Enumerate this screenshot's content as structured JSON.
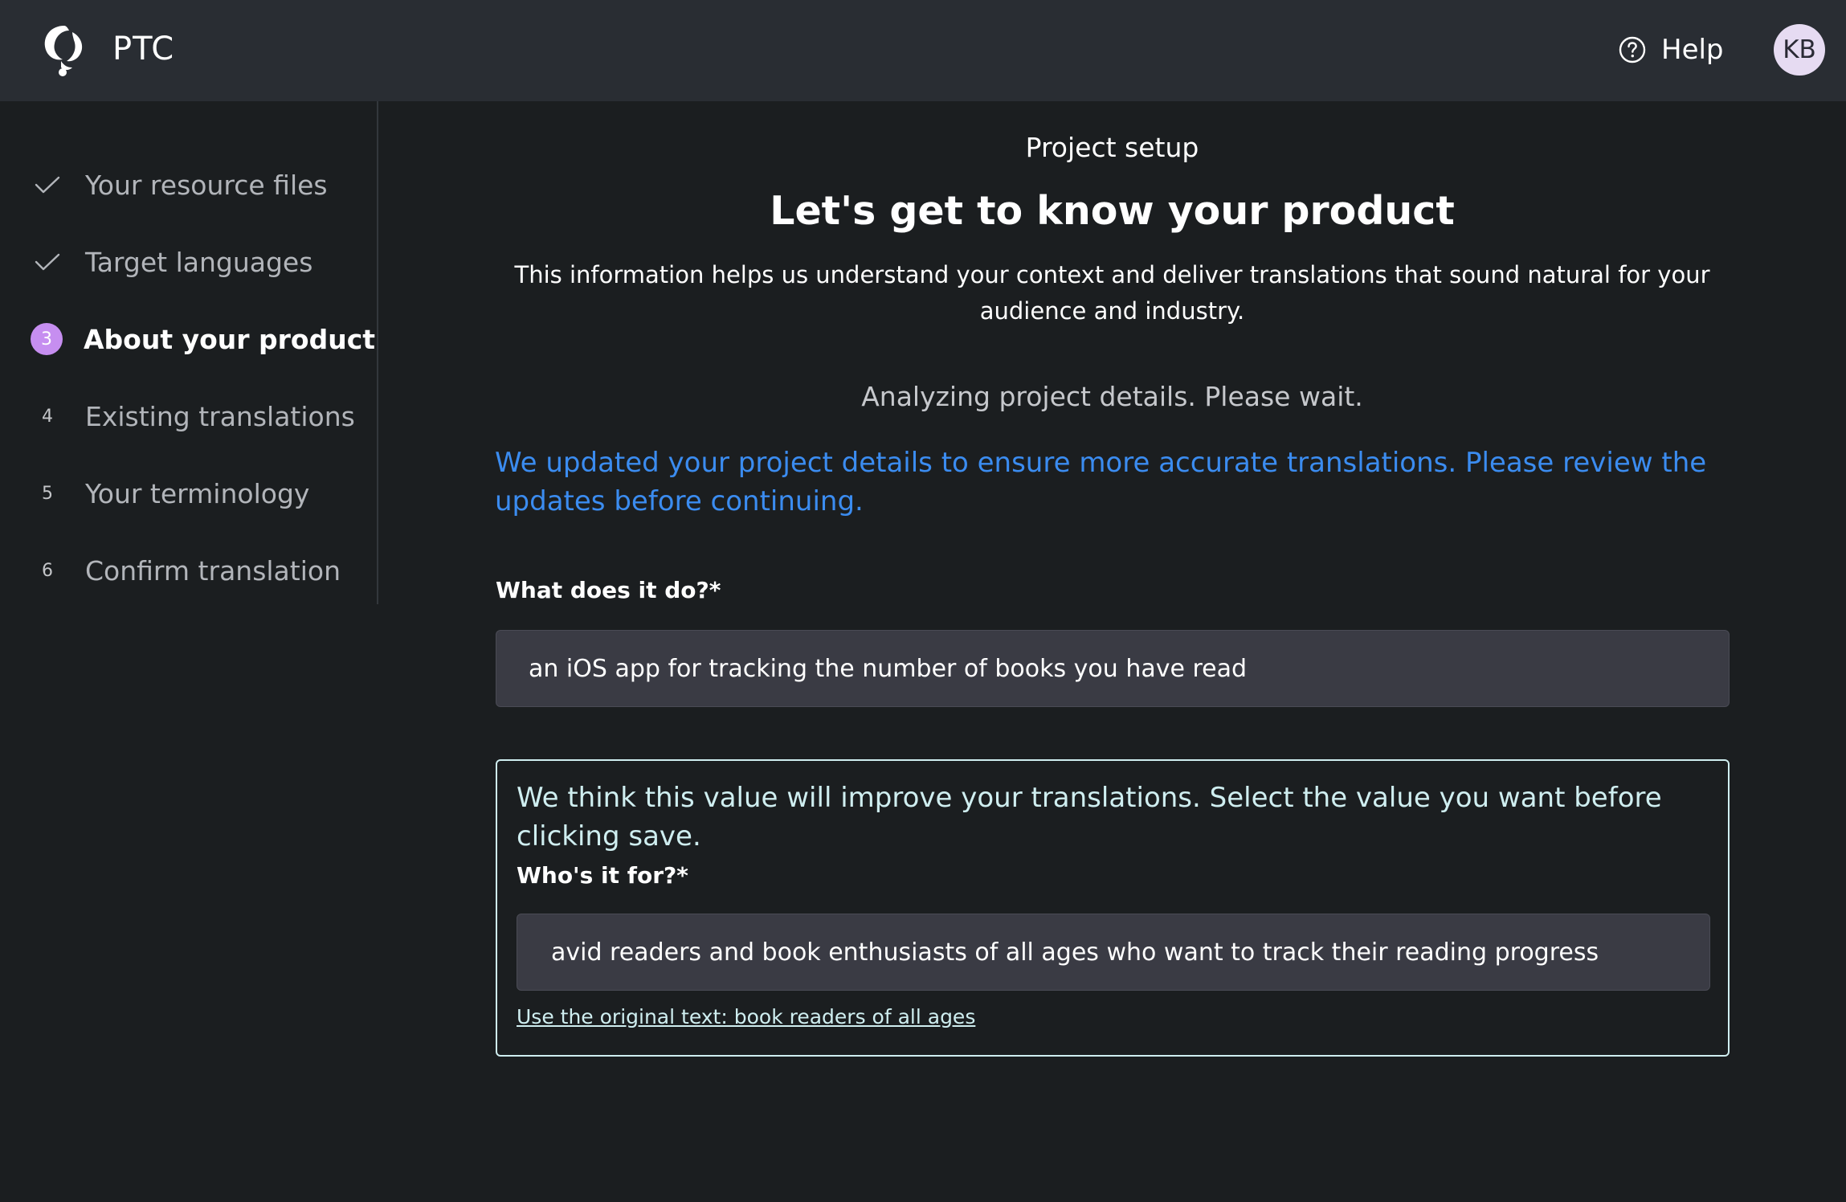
{
  "header": {
    "brand": "PTC",
    "help_label": "Help",
    "avatar_initials": "KB"
  },
  "sidebar": {
    "steps": [
      {
        "marker": "check-icon",
        "label": "Your resource files",
        "state": "done"
      },
      {
        "marker": "check-icon",
        "label": "Target languages",
        "state": "done"
      },
      {
        "marker": "3",
        "label": "About your product",
        "state": "active"
      },
      {
        "marker": "4",
        "label": "Existing translations",
        "state": "pending"
      },
      {
        "marker": "5",
        "label": "Your terminology",
        "state": "pending"
      },
      {
        "marker": "6",
        "label": "Confirm translation",
        "state": "pending"
      }
    ]
  },
  "main": {
    "eyebrow": "Project setup",
    "title": "Let's get to know your product",
    "description": "This information helps us understand your context and deliver translations that sound natural for your audience and industry.",
    "analyzing": "Analyzing project details. Please wait.",
    "update_note": "We updated your project details to ensure more accurate translations. Please review the updates before continuing.",
    "what_label": "What does it do?*",
    "what_value": "an iOS app for tracking the number of books you have read",
    "suggestion": {
      "text": "We think this value will improve your translations. Select the value you want before clicking save.",
      "label": "Who's it for?*",
      "value": "avid readers and book enthusiasts of all ages who want to track their reading progress",
      "original_link": "Use the original text: book readers of all ages"
    }
  },
  "colors": {
    "background": "#1b1e20",
    "topbar": "#292d33",
    "accent_purple": "#c68ef0",
    "update_blue": "#3b8cf0",
    "suggest_border": "#cfeef0",
    "input_bg": "#3a3b44"
  }
}
